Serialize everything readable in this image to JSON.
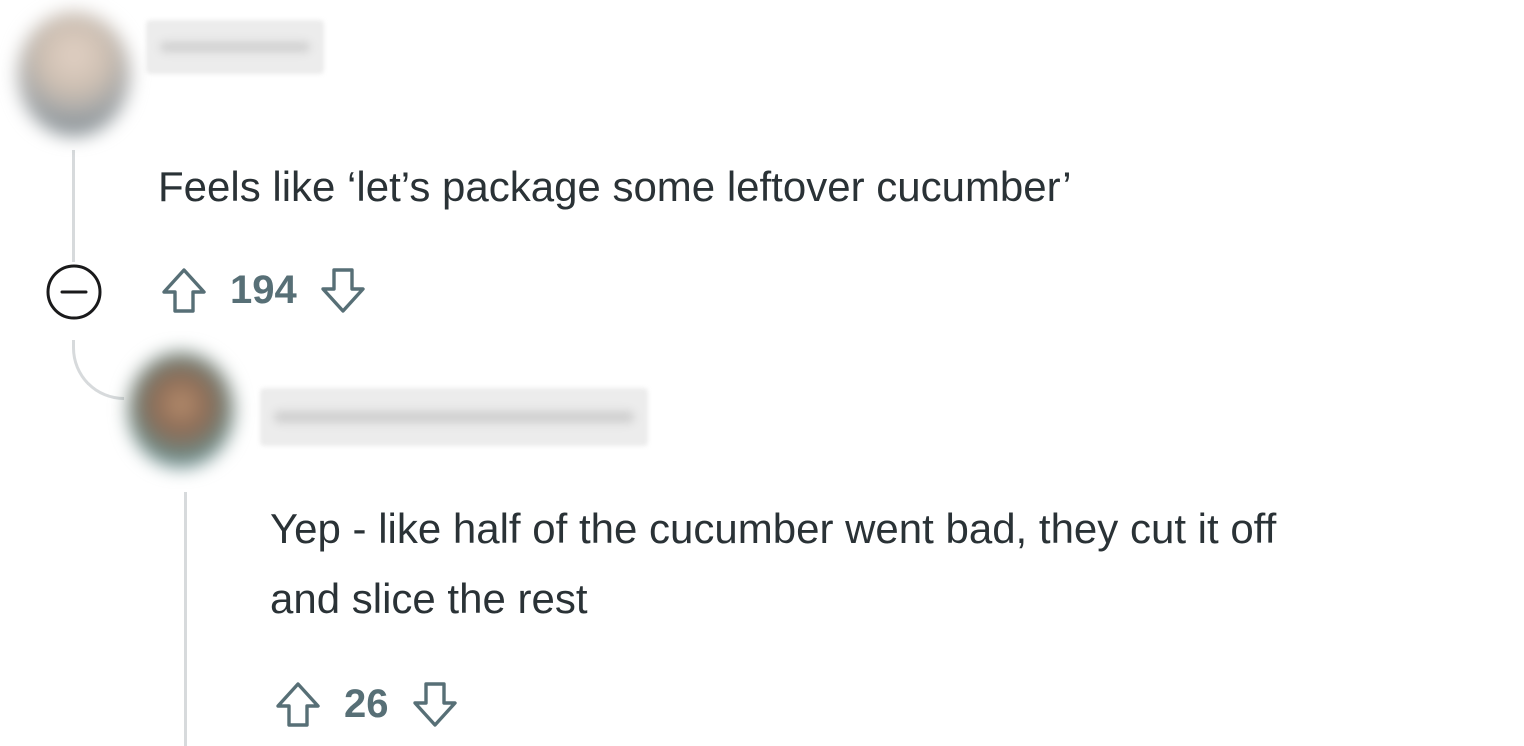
{
  "comments": [
    {
      "username": "",
      "text": "Feels like ‘let’s package some leftover cucumber’",
      "score": "194",
      "icons": {
        "upvote": "arrow-up-outline-icon",
        "downvote": "arrow-down-outline-icon",
        "collapse": "minus-circle-icon"
      }
    },
    {
      "username": "",
      "text_line_1": "Yep - like half of the cucumber went bad, they cut it off",
      "text_line_2": "and slice the rest",
      "score": "26",
      "icons": {
        "upvote": "arrow-up-outline-icon",
        "downvote": "arrow-down-outline-icon"
      }
    }
  ],
  "colors": {
    "text": "#2a3236",
    "vote_count": "#576f76",
    "thread_line": "#d7dadc",
    "background": "#ffffff"
  }
}
